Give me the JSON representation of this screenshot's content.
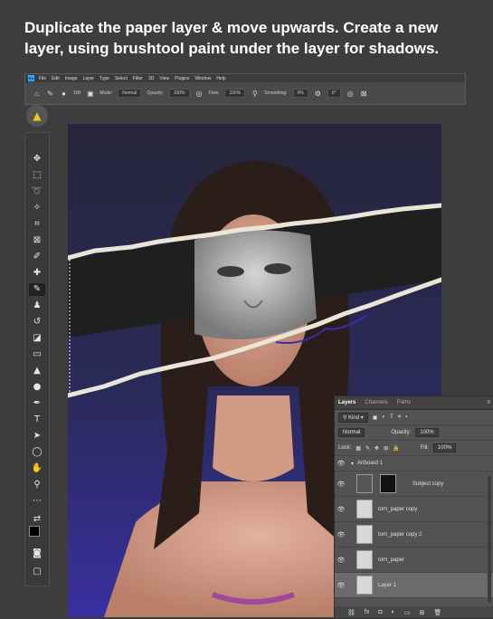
{
  "caption": "Duplicate the paper layer & move upwards. Create a new layer, using brushtool paint under the layer for shadows.",
  "menu": [
    "File",
    "Edit",
    "Image",
    "Layer",
    "Type",
    "Select",
    "Filter",
    "3D",
    "View",
    "Plugins",
    "Window",
    "Help"
  ],
  "options_bar": {
    "mode_label": "Mode:",
    "mode_value": "Normal",
    "opacity_label": "Opacity:",
    "opacity_value": "100%",
    "flow_label": "Flow:",
    "flow_value": "100%",
    "smoothing_label": "Smoothing:",
    "smoothing_value": "0%",
    "angle_value": "0°",
    "brush_size": "100"
  },
  "layers_panel": {
    "tabs": [
      "Layers",
      "Channels",
      "Paths"
    ],
    "filter_kind": "Kind",
    "blend_mode": "Normal",
    "opacity_label": "Opacity:",
    "opacity_value": "100%",
    "lock_label": "Lock:",
    "fill_label": "Fill:",
    "fill_value": "100%",
    "artboard": "Artboard 1",
    "layers": [
      {
        "name": "Subject copy"
      },
      {
        "name": "torn_paper copy"
      },
      {
        "name": "torn_paper copy 2"
      },
      {
        "name": "torn_paper"
      },
      {
        "name": "Layer 1",
        "selected": true
      }
    ]
  },
  "colors": {
    "background": "#3d3d3d",
    "accent": "#31a8ff",
    "paper": "#e8e2d6"
  }
}
